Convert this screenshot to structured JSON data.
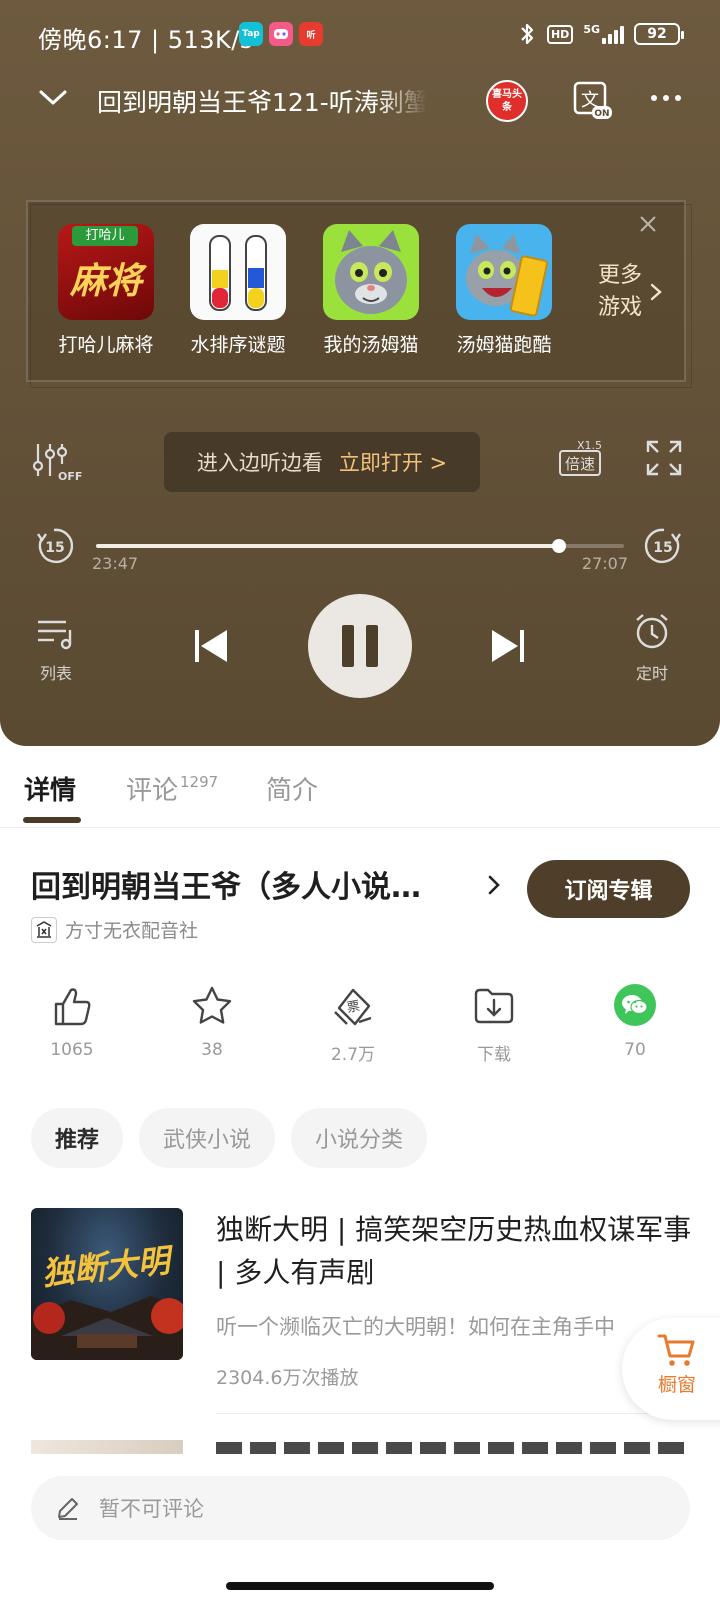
{
  "status_bar": {
    "time": "傍晚6:17 | 513K/s",
    "app_taptap": "Tap",
    "app_ting": "听",
    "network": "5G",
    "hd": "HD",
    "battery": "92"
  },
  "header": {
    "episode_title": "回到明朝当王爷121-听涛剥蟹",
    "brand_badge": "喜马头条"
  },
  "games": {
    "items": [
      {
        "name": "打哈儿麻将"
      },
      {
        "name": "水排序谜题"
      },
      {
        "name": "我的汤姆猫"
      },
      {
        "name": "汤姆猫跑酷"
      }
    ],
    "icon_text_mahjong_top": "打哈儿",
    "icon_text_mahjong": "麻将",
    "more_line1": "更多",
    "more_line2": "游戏"
  },
  "player": {
    "eq_off": "OFF",
    "immersive_text": "进入边听边看",
    "immersive_link": "立即打开 >",
    "speed_top": "X1.5",
    "speed_label": "倍速",
    "skip_seconds": "15",
    "current_time": "23:47",
    "total_time": "27:07",
    "progress": 0.877,
    "list_label": "列表",
    "timer_label": "定时"
  },
  "tabs": {
    "details": "详情",
    "comments": "评论",
    "comments_count": "1297",
    "intro": "简介"
  },
  "album": {
    "title": "回到明朝当王爷（多人小说…",
    "subscribe": "订阅专辑",
    "publisher": "方寸无衣配音社"
  },
  "actions": {
    "like": "1065",
    "favorite": "38",
    "ticket": "2.7万",
    "download": "下载",
    "share": "70"
  },
  "chips": [
    "推荐",
    "武侠小说",
    "小说分类"
  ],
  "recommend": {
    "title": "独断大明 | 搞笑架空历史热血权谋军事 | 多人有声剧",
    "desc": "听一个濒临灭亡的大明朝！如何在主角手中",
    "plays": "2304.6万次播放",
    "cover_text": "独断大明"
  },
  "shop": {
    "label": "橱窗"
  },
  "comment_bar": {
    "placeholder": "暂不可评论"
  },
  "colors": {
    "player_bg": "#5f4e36",
    "accent_brown": "#4f3f2a",
    "link_gold": "#f2c27a",
    "wechat_green": "#3fc55a",
    "shop_orange": "#e87a2e"
  }
}
